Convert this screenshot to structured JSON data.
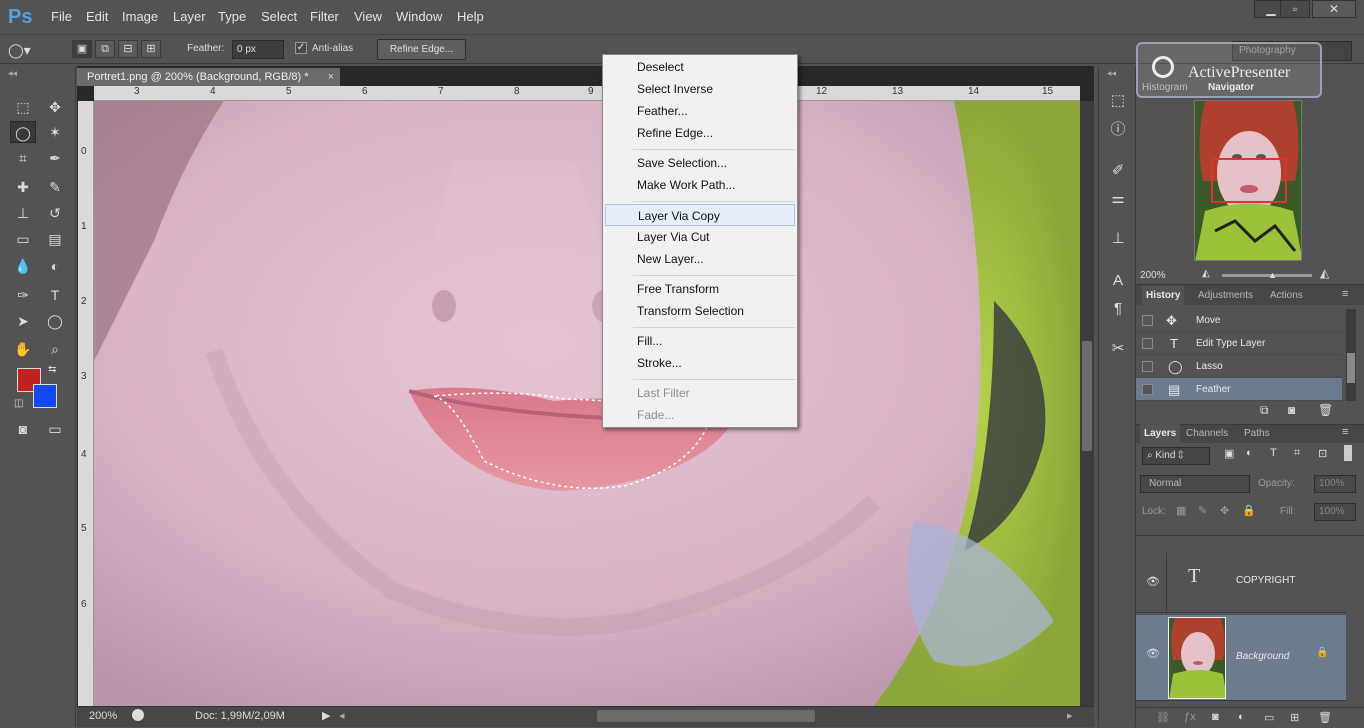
{
  "app": {
    "logo": "Ps"
  },
  "menu": [
    "File",
    "Edit",
    "Image",
    "Layer",
    "Type",
    "Select",
    "Filter",
    "View",
    "Window",
    "Help"
  ],
  "window_controls": [
    "minimize-icon",
    "restore-icon",
    "close-icon"
  ],
  "options": {
    "feather_label": "Feather:",
    "feather_value": "0 px",
    "antialias_label": "Anti-alias",
    "refine_edge": "Refine Edge...",
    "workspace": "Photography"
  },
  "document": {
    "tab_title": "Portret1.png @ 200% (Background, RGB/8) *",
    "close": "×",
    "zoom": "200%",
    "doc_info": "Doc: 1,99M/2,09M"
  },
  "ruler": {
    "top_ticks": [
      "3",
      "4",
      "5",
      "6",
      "7",
      "8",
      "9",
      "10",
      "11",
      "12",
      "13",
      "14",
      "15"
    ],
    "left_ticks": [
      "0",
      "1",
      "2",
      "3",
      "4",
      "5",
      "6"
    ]
  },
  "context_menu": {
    "items": [
      {
        "label": "Deselect",
        "state": "normal"
      },
      {
        "label": "Select Inverse",
        "state": "normal"
      },
      {
        "label": "Feather...",
        "state": "normal"
      },
      {
        "label": "Refine Edge...",
        "state": "normal"
      },
      {
        "sep": true
      },
      {
        "label": "Save Selection...",
        "state": "normal"
      },
      {
        "label": "Make Work Path...",
        "state": "normal"
      },
      {
        "sep": true
      },
      {
        "label": "Layer Via Copy",
        "state": "highlighted"
      },
      {
        "label": "Layer Via Cut",
        "state": "normal"
      },
      {
        "label": "New Layer...",
        "state": "normal"
      },
      {
        "sep": true
      },
      {
        "label": "Free Transform",
        "state": "normal"
      },
      {
        "label": "Transform Selection",
        "state": "normal"
      },
      {
        "sep": true
      },
      {
        "label": "Fill...",
        "state": "normal"
      },
      {
        "label": "Stroke...",
        "state": "normal"
      },
      {
        "sep": true
      },
      {
        "label": "Last Filter",
        "state": "disabled"
      },
      {
        "label": "Fade...",
        "state": "disabled"
      }
    ]
  },
  "navigator": {
    "tabs": [
      "Histogram",
      "Navigator"
    ],
    "zoom": "200%"
  },
  "history": {
    "tabs": [
      "History",
      "Adjustments",
      "Actions"
    ],
    "items": [
      {
        "label": "Move",
        "icon": "move-icon",
        "selected": false
      },
      {
        "label": "Edit Type Layer",
        "icon": "type-icon",
        "selected": false
      },
      {
        "label": "Lasso",
        "icon": "lasso-icon",
        "selected": false
      },
      {
        "label": "Feather",
        "icon": "feather-icon",
        "selected": true
      }
    ]
  },
  "layers": {
    "tabs": [
      "Layers",
      "Channels",
      "Paths"
    ],
    "filter_kind": "Kind",
    "blend_mode": "Normal",
    "opacity_label": "Opacity:",
    "opacity_value": "100%",
    "lock_label": "Lock:",
    "fill_label": "Fill:",
    "fill_value": "100%",
    "items": [
      {
        "name": "COPYRIGHT",
        "kind": "text"
      },
      {
        "name": "Background",
        "kind": "image",
        "selected": true
      }
    ]
  },
  "watermark": {
    "text": "ActivePresenter"
  },
  "colors": {
    "foreground": "#c0201e",
    "background": "#1448f0",
    "selection_highlight": "#6d7b8f",
    "nav_box": "#e03030"
  }
}
